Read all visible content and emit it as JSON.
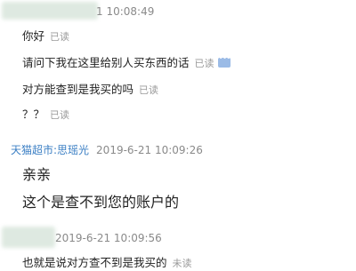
{
  "conversation": [
    {
      "type": "header",
      "sender": "",
      "time": "1 10:08:49",
      "blurred": true
    },
    {
      "type": "msg",
      "text": "你好",
      "status": "已读"
    },
    {
      "type": "msg",
      "text": "请问下我在这里给别人买东西的话",
      "status": "已读",
      "icon": "chat-bubble-icon"
    },
    {
      "type": "msg",
      "text": "对方能查到是我买的吗",
      "status": "已读"
    },
    {
      "type": "msg",
      "text": "？？",
      "status": "已读"
    },
    {
      "type": "header",
      "sender": "天猫超市:思瑶光",
      "time": "2019-6-21 10:09:26"
    },
    {
      "type": "msg",
      "text": "亲亲"
    },
    {
      "type": "msg",
      "text": "这个是查不到您的账户的"
    },
    {
      "type": "header",
      "sender": "",
      "time": "2019-6-21 10:09:56",
      "blurred": true
    },
    {
      "type": "msg",
      "text": "也就是说对方查不到是我买的",
      "status": "未读"
    }
  ],
  "colors": {
    "sender": "#3b7fc4",
    "timestamp": "#8a8a8a",
    "read_status": "#9a9a9a"
  }
}
